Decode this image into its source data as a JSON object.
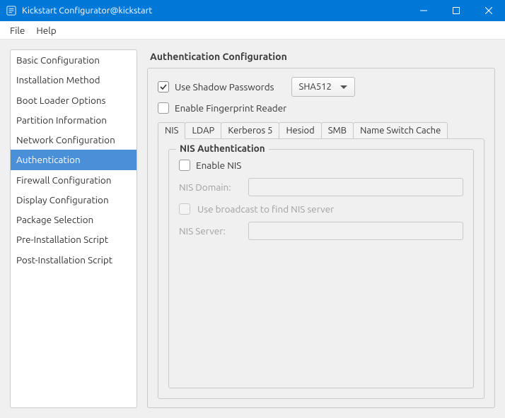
{
  "titlebar": {
    "title": "Kickstart Configurator@kickstart"
  },
  "menubar": {
    "file": "File",
    "help": "Help"
  },
  "sidebar": {
    "items": [
      {
        "label": "Basic Configuration"
      },
      {
        "label": "Installation Method"
      },
      {
        "label": "Boot Loader Options"
      },
      {
        "label": "Partition Information"
      },
      {
        "label": "Network Configuration"
      },
      {
        "label": "Authentication"
      },
      {
        "label": "Firewall Configuration"
      },
      {
        "label": "Display Configuration"
      },
      {
        "label": "Package Selection"
      },
      {
        "label": "Pre-Installation Script"
      },
      {
        "label": "Post-Installation Script"
      }
    ],
    "selected_index": 5
  },
  "main": {
    "heading": "Authentication Configuration",
    "shadow_passwords_label": "Use Shadow Passwords",
    "shadow_passwords_checked": true,
    "hash_algo_selected": "SHA512",
    "fingerprint_label": "Enable Fingerprint Reader",
    "fingerprint_checked": false,
    "tabs": [
      {
        "label": "NIS"
      },
      {
        "label": "LDAP"
      },
      {
        "label": "Kerberos 5"
      },
      {
        "label": "Hesiod"
      },
      {
        "label": "SMB"
      },
      {
        "label": "Name Switch Cache"
      }
    ],
    "active_tab_index": 0,
    "nis": {
      "legend": "NIS Authentication",
      "enable_label": "Enable NIS",
      "enable_checked": false,
      "domain_label": "NIS Domain:",
      "domain_value": "",
      "broadcast_label": "Use broadcast to find NIS server",
      "broadcast_checked": false,
      "server_label": "NIS Server:",
      "server_value": ""
    }
  }
}
